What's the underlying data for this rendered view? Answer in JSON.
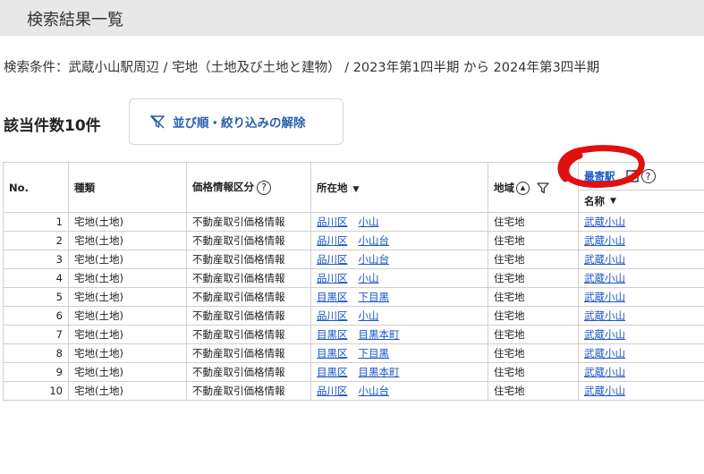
{
  "header": {
    "title": "検索結果一覧"
  },
  "criteria": {
    "text": "検索条件：武蔵小山駅周辺 / 宅地（土地及び土地と建物） / 2023年第1四半期 から 2024年第3四半期"
  },
  "summary": {
    "count_label": "該当件数10件"
  },
  "reset_button": {
    "label": "並び順・絞り込みの解除",
    "icon": "filter-off-icon"
  },
  "table": {
    "headers": {
      "no": "No.",
      "type": "種類",
      "price_info": "価格情報区分",
      "location": "所在地",
      "region": "地域",
      "station": "最寄駅",
      "station_name": "名称",
      "help_mark": "?",
      "sort_mark": "▼",
      "up_mark": "▲"
    },
    "rows": [
      {
        "no": "1",
        "type": "宅地(土地)",
        "price": "不動産取引価格情報",
        "ward": "品川区",
        "area": "小山",
        "region": "住宅地",
        "station": "武蔵小山"
      },
      {
        "no": "2",
        "type": "宅地(土地)",
        "price": "不動産取引価格情報",
        "ward": "品川区",
        "area": "小山台",
        "region": "住宅地",
        "station": "武蔵小山"
      },
      {
        "no": "3",
        "type": "宅地(土地)",
        "price": "不動産取引価格情報",
        "ward": "品川区",
        "area": "小山台",
        "region": "住宅地",
        "station": "武蔵小山"
      },
      {
        "no": "4",
        "type": "宅地(土地)",
        "price": "不動産取引価格情報",
        "ward": "品川区",
        "area": "小山",
        "region": "住宅地",
        "station": "武蔵小山"
      },
      {
        "no": "5",
        "type": "宅地(土地)",
        "price": "不動産取引価格情報",
        "ward": "目黒区",
        "area": "下目黒",
        "region": "住宅地",
        "station": "武蔵小山"
      },
      {
        "no": "6",
        "type": "宅地(土地)",
        "price": "不動産取引価格情報",
        "ward": "品川区",
        "area": "小山",
        "region": "住宅地",
        "station": "武蔵小山"
      },
      {
        "no": "7",
        "type": "宅地(土地)",
        "price": "不動産取引価格情報",
        "ward": "目黒区",
        "area": "目黒本町",
        "region": "住宅地",
        "station": "武蔵小山"
      },
      {
        "no": "8",
        "type": "宅地(土地)",
        "price": "不動産取引価格情報",
        "ward": "目黒区",
        "area": "下目黒",
        "region": "住宅地",
        "station": "武蔵小山"
      },
      {
        "no": "9",
        "type": "宅地(土地)",
        "price": "不動産取引価格情報",
        "ward": "目黒区",
        "area": "目黒本町",
        "region": "住宅地",
        "station": "武蔵小山"
      },
      {
        "no": "10",
        "type": "宅地(土地)",
        "price": "不動産取引価格情報",
        "ward": "品川区",
        "area": "小山台",
        "region": "住宅地",
        "station": "武蔵小山"
      }
    ]
  },
  "colors": {
    "link": "#1a56c9",
    "header_bg": "#e8e8e8",
    "annotation": "#e01010"
  }
}
